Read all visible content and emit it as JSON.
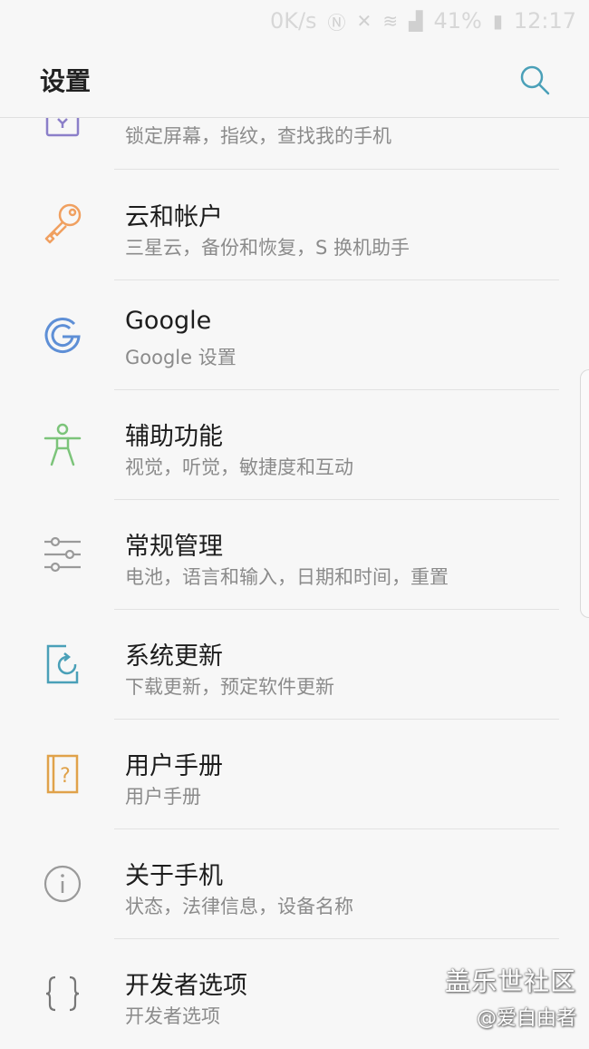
{
  "status_bar": {
    "net_speed": "0K/s",
    "battery": "41%",
    "time": "12:17"
  },
  "header": {
    "title": "设置",
    "search_icon": "search-icon"
  },
  "colors": {
    "purple": "#8b7fc9",
    "orange": "#f0a060",
    "blue": "#5e8fd6",
    "green": "#7cc47a",
    "gray": "#9a9a9a",
    "teal": "#4aa0b8",
    "gold": "#e0a24a"
  },
  "items": [
    {
      "title": "",
      "subtitle": "锁定屏幕，指纹，查找我的手机",
      "icon": "lock-screen-icon"
    },
    {
      "title": "云和帐户",
      "subtitle": "三星云，备份和恢复，S 换机助手",
      "icon": "key-icon"
    },
    {
      "title": "Google",
      "subtitle": "Google 设置",
      "icon": "google-icon"
    },
    {
      "title": "辅助功能",
      "subtitle": "视觉，听觉，敏捷度和互动",
      "icon": "accessibility-icon"
    },
    {
      "title": "常规管理",
      "subtitle": "电池，语言和输入，日期和时间，重置",
      "icon": "sliders-icon"
    },
    {
      "title": "系统更新",
      "subtitle": "下载更新，预定软件更新",
      "icon": "system-update-icon"
    },
    {
      "title": "用户手册",
      "subtitle": "用户手册",
      "icon": "user-manual-icon"
    },
    {
      "title": "关于手机",
      "subtitle": "状态，法律信息，设备名称",
      "icon": "info-icon"
    },
    {
      "title": "开发者选项",
      "subtitle": "开发者选项",
      "icon": "developer-braces-icon"
    }
  ],
  "watermark": {
    "main": "盖乐世社区",
    "sub": "@爱自由者"
  }
}
